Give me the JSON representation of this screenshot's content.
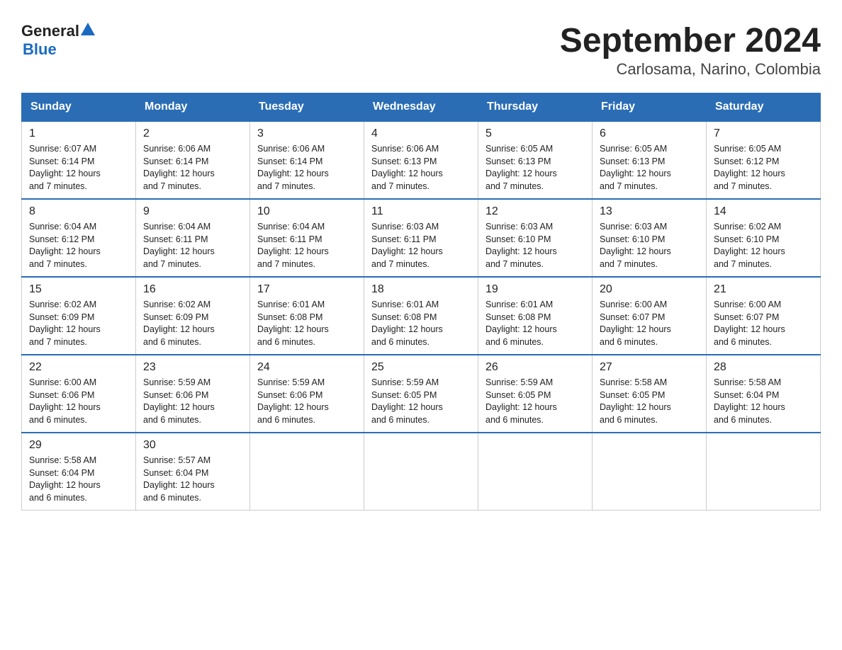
{
  "header": {
    "logo_general": "General",
    "logo_blue": "Blue",
    "title": "September 2024",
    "subtitle": "Carlosama, Narino, Colombia"
  },
  "days_of_week": [
    "Sunday",
    "Monday",
    "Tuesday",
    "Wednesday",
    "Thursday",
    "Friday",
    "Saturday"
  ],
  "weeks": [
    [
      {
        "day": "1",
        "sunrise": "6:07 AM",
        "sunset": "6:14 PM",
        "daylight": "12 hours and 7 minutes."
      },
      {
        "day": "2",
        "sunrise": "6:06 AM",
        "sunset": "6:14 PM",
        "daylight": "12 hours and 7 minutes."
      },
      {
        "day": "3",
        "sunrise": "6:06 AM",
        "sunset": "6:14 PM",
        "daylight": "12 hours and 7 minutes."
      },
      {
        "day": "4",
        "sunrise": "6:06 AM",
        "sunset": "6:13 PM",
        "daylight": "12 hours and 7 minutes."
      },
      {
        "day": "5",
        "sunrise": "6:05 AM",
        "sunset": "6:13 PM",
        "daylight": "12 hours and 7 minutes."
      },
      {
        "day": "6",
        "sunrise": "6:05 AM",
        "sunset": "6:13 PM",
        "daylight": "12 hours and 7 minutes."
      },
      {
        "day": "7",
        "sunrise": "6:05 AM",
        "sunset": "6:12 PM",
        "daylight": "12 hours and 7 minutes."
      }
    ],
    [
      {
        "day": "8",
        "sunrise": "6:04 AM",
        "sunset": "6:12 PM",
        "daylight": "12 hours and 7 minutes."
      },
      {
        "day": "9",
        "sunrise": "6:04 AM",
        "sunset": "6:11 PM",
        "daylight": "12 hours and 7 minutes."
      },
      {
        "day": "10",
        "sunrise": "6:04 AM",
        "sunset": "6:11 PM",
        "daylight": "12 hours and 7 minutes."
      },
      {
        "day": "11",
        "sunrise": "6:03 AM",
        "sunset": "6:11 PM",
        "daylight": "12 hours and 7 minutes."
      },
      {
        "day": "12",
        "sunrise": "6:03 AM",
        "sunset": "6:10 PM",
        "daylight": "12 hours and 7 minutes."
      },
      {
        "day": "13",
        "sunrise": "6:03 AM",
        "sunset": "6:10 PM",
        "daylight": "12 hours and 7 minutes."
      },
      {
        "day": "14",
        "sunrise": "6:02 AM",
        "sunset": "6:10 PM",
        "daylight": "12 hours and 7 minutes."
      }
    ],
    [
      {
        "day": "15",
        "sunrise": "6:02 AM",
        "sunset": "6:09 PM",
        "daylight": "12 hours and 7 minutes."
      },
      {
        "day": "16",
        "sunrise": "6:02 AM",
        "sunset": "6:09 PM",
        "daylight": "12 hours and 6 minutes."
      },
      {
        "day": "17",
        "sunrise": "6:01 AM",
        "sunset": "6:08 PM",
        "daylight": "12 hours and 6 minutes."
      },
      {
        "day": "18",
        "sunrise": "6:01 AM",
        "sunset": "6:08 PM",
        "daylight": "12 hours and 6 minutes."
      },
      {
        "day": "19",
        "sunrise": "6:01 AM",
        "sunset": "6:08 PM",
        "daylight": "12 hours and 6 minutes."
      },
      {
        "day": "20",
        "sunrise": "6:00 AM",
        "sunset": "6:07 PM",
        "daylight": "12 hours and 6 minutes."
      },
      {
        "day": "21",
        "sunrise": "6:00 AM",
        "sunset": "6:07 PM",
        "daylight": "12 hours and 6 minutes."
      }
    ],
    [
      {
        "day": "22",
        "sunrise": "6:00 AM",
        "sunset": "6:06 PM",
        "daylight": "12 hours and 6 minutes."
      },
      {
        "day": "23",
        "sunrise": "5:59 AM",
        "sunset": "6:06 PM",
        "daylight": "12 hours and 6 minutes."
      },
      {
        "day": "24",
        "sunrise": "5:59 AM",
        "sunset": "6:06 PM",
        "daylight": "12 hours and 6 minutes."
      },
      {
        "day": "25",
        "sunrise": "5:59 AM",
        "sunset": "6:05 PM",
        "daylight": "12 hours and 6 minutes."
      },
      {
        "day": "26",
        "sunrise": "5:59 AM",
        "sunset": "6:05 PM",
        "daylight": "12 hours and 6 minutes."
      },
      {
        "day": "27",
        "sunrise": "5:58 AM",
        "sunset": "6:05 PM",
        "daylight": "12 hours and 6 minutes."
      },
      {
        "day": "28",
        "sunrise": "5:58 AM",
        "sunset": "6:04 PM",
        "daylight": "12 hours and 6 minutes."
      }
    ],
    [
      {
        "day": "29",
        "sunrise": "5:58 AM",
        "sunset": "6:04 PM",
        "daylight": "12 hours and 6 minutes."
      },
      {
        "day": "30",
        "sunrise": "5:57 AM",
        "sunset": "6:04 PM",
        "daylight": "12 hours and 6 minutes."
      },
      null,
      null,
      null,
      null,
      null
    ]
  ],
  "labels": {
    "sunrise": "Sunrise:",
    "sunset": "Sunset:",
    "daylight": "Daylight:"
  }
}
